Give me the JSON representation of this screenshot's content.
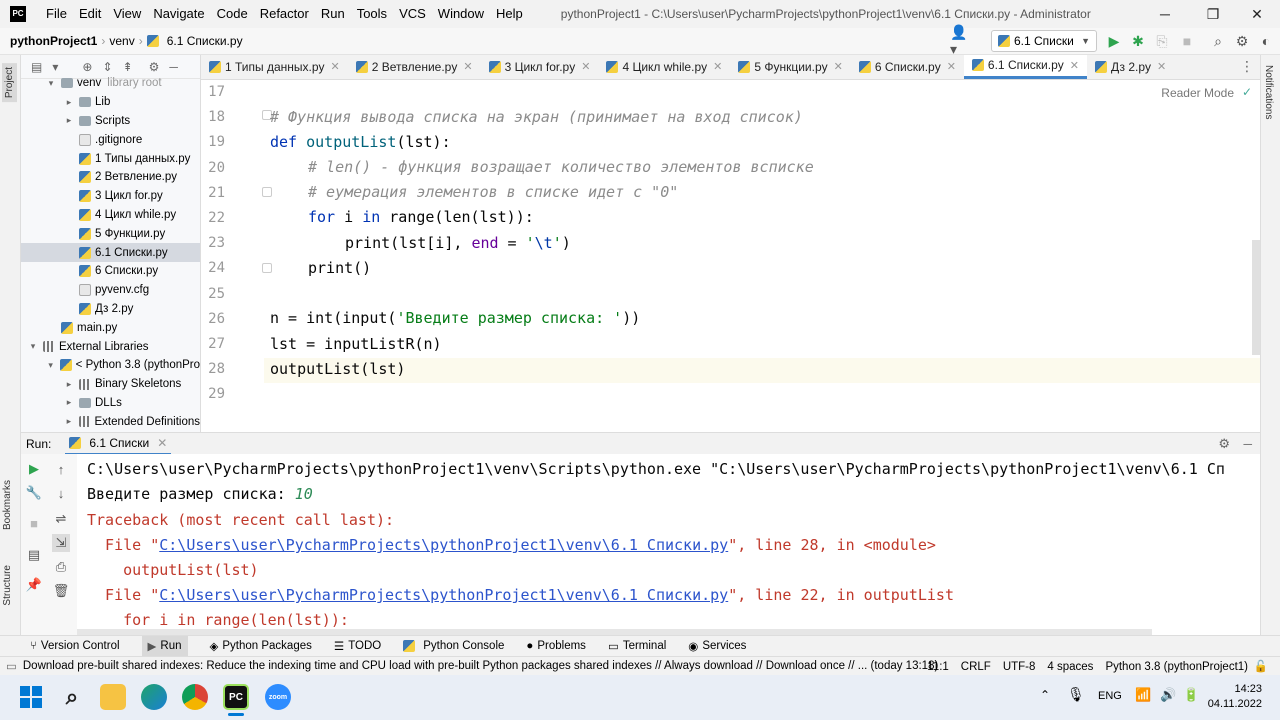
{
  "app": {
    "logo": "PC"
  },
  "menu": [
    "File",
    "Edit",
    "View",
    "Navigate",
    "Code",
    "Refactor",
    "Run",
    "Tools",
    "VCS",
    "Window",
    "Help"
  ],
  "window_title": "pythonProject1 - C:\\Users\\user\\PycharmProjects\\pythonProject1\\venv\\6.1 Списки.py - Administrator",
  "breadcrumbs": [
    "pythonProject1",
    "venv",
    "6.1 Списки.py"
  ],
  "run_config": "6.1 Списки",
  "left_tabs": {
    "project": "Project",
    "bookmarks": "Bookmarks",
    "structure": "Structure"
  },
  "right_tabs": {
    "notifications": "Notifications"
  },
  "project_tree": [
    {
      "label": "venv",
      "suffix": "library root",
      "indent": 0,
      "arrow": "▾",
      "icon": "folder"
    },
    {
      "label": "Lib",
      "indent": 1,
      "arrow": "▸",
      "icon": "folder"
    },
    {
      "label": "Scripts",
      "indent": 1,
      "arrow": "▸",
      "icon": "folder"
    },
    {
      "label": ".gitignore",
      "indent": 1,
      "arrow": "",
      "icon": "file"
    },
    {
      "label": "1 Типы данных.py",
      "indent": 1,
      "arrow": "",
      "icon": "py"
    },
    {
      "label": "2 Ветвление.py",
      "indent": 1,
      "arrow": "",
      "icon": "py"
    },
    {
      "label": "3 Цикл for.py",
      "indent": 1,
      "arrow": "",
      "icon": "py"
    },
    {
      "label": "4 Цикл while.py",
      "indent": 1,
      "arrow": "",
      "icon": "py"
    },
    {
      "label": "5 Функции.py",
      "indent": 1,
      "arrow": "",
      "icon": "py"
    },
    {
      "label": "6.1 Списки.py",
      "indent": 1,
      "arrow": "",
      "icon": "py",
      "selected": true
    },
    {
      "label": "6 Списки.py",
      "indent": 1,
      "arrow": "",
      "icon": "py"
    },
    {
      "label": "pyvenv.cfg",
      "indent": 1,
      "arrow": "",
      "icon": "file"
    },
    {
      "label": "Дз 2.py",
      "indent": 1,
      "arrow": "",
      "icon": "py"
    },
    {
      "label": "main.py",
      "indent": 0,
      "arrow": "",
      "icon": "py"
    },
    {
      "label": "External Libraries",
      "indent": -1,
      "arrow": "▾",
      "icon": "lib"
    },
    {
      "label": "< Python 3.8 (pythonPro",
      "indent": 0,
      "arrow": "▾",
      "icon": "py"
    },
    {
      "label": "Binary Skeletons",
      "indent": 1,
      "arrow": "▸",
      "icon": "lib"
    },
    {
      "label": "DLLs",
      "indent": 1,
      "arrow": "▸",
      "icon": "folder"
    },
    {
      "label": "Extended Definitions",
      "indent": 1,
      "arrow": "▸",
      "icon": "lib"
    }
  ],
  "editor_tabs": [
    "1 Типы данных.py",
    "2 Ветвление.py",
    "3 Цикл for.py",
    "4 Цикл while.py",
    "5 Функции.py",
    "6 Списки.py",
    "6.1 Списки.py",
    "Дз 2.py"
  ],
  "active_tab_index": 6,
  "reader_mode": "Reader Mode",
  "line_numbers": [
    "17",
    "18",
    "19",
    "20",
    "21",
    "22",
    "23",
    "24",
    "25",
    "26",
    "27",
    "28",
    "29"
  ],
  "code": {
    "l18": "# Функция вывода списка на экран (принимает на вход список)",
    "l19_kw": "def",
    "l19_fn": "outputList",
    "l19_rest": "(lst):",
    "l20": "# len() - функция возращает количество элементов всписке",
    "l21": "# еумерация элементов в списке идет с \"0\"",
    "l22_kw1": "for",
    "l22_mid": " i ",
    "l22_kw2": "in",
    "l22_rest": " range(len(lst)):",
    "l23_a": "print(lst[i], ",
    "l23_kw": "end",
    "l23_b": " = ",
    "l23_s1": "'",
    "l23_esc": "\\t",
    "l23_s2": "'",
    "l23_c": ")",
    "l24": "print()",
    "l26_a": "n = int(input(",
    "l26_str": "'Введите размер списка: '",
    "l26_b": "))",
    "l27": "lst = inputListR(n)",
    "l28": "outputList(lst)"
  },
  "run_panel": {
    "label": "Run:",
    "tab": "6.1 Списки"
  },
  "console": {
    "line1": "C:\\Users\\user\\PycharmProjects\\pythonProject1\\venv\\Scripts\\python.exe \"C:\\Users\\user\\PycharmProjects\\pythonProject1\\venv\\6.1 Сп",
    "line2_prompt": "Введите размер списка: ",
    "line2_input": "10",
    "line3": "Traceback (most recent call last):",
    "line4_a": "  File \"",
    "line4_link": "C:\\Users\\user\\PycharmProjects\\pythonProject1\\venv\\6.1 Списки.py",
    "line4_b": "\", line 28, in <module>",
    "line5": "    outputList(lst)",
    "line6_a": "  File \"",
    "line6_link": "C:\\Users\\user\\PycharmProjects\\pythonProject1\\venv\\6.1 Списки.py",
    "line6_b": "\", line 22, in outputList",
    "line7": "    for i in range(len(lst)):"
  },
  "bottom_tabs": [
    "Version Control",
    "Run",
    "Python Packages",
    "TODO",
    "Python Console",
    "Problems",
    "Terminal",
    "Services"
  ],
  "status": {
    "message": "Download pre-built shared indexes: Reduce the indexing time and CPU load with pre-built Python packages shared indexes // Always download // Download once // ... (today 13:18)",
    "position": "11:1",
    "line_sep": "CRLF",
    "encoding": "UTF-8",
    "indent": "4 spaces",
    "interpreter": "Python 3.8 (pythonProject1)"
  },
  "taskbar": {
    "lang": "ENG",
    "time": "14:23",
    "date": "04.11.2022"
  },
  "colors": {
    "accent": "#4083c9",
    "keyword": "#0033b3",
    "function": "#00627a",
    "string": "#067d17",
    "error": "#c0392b",
    "link": "#2c54cc"
  }
}
